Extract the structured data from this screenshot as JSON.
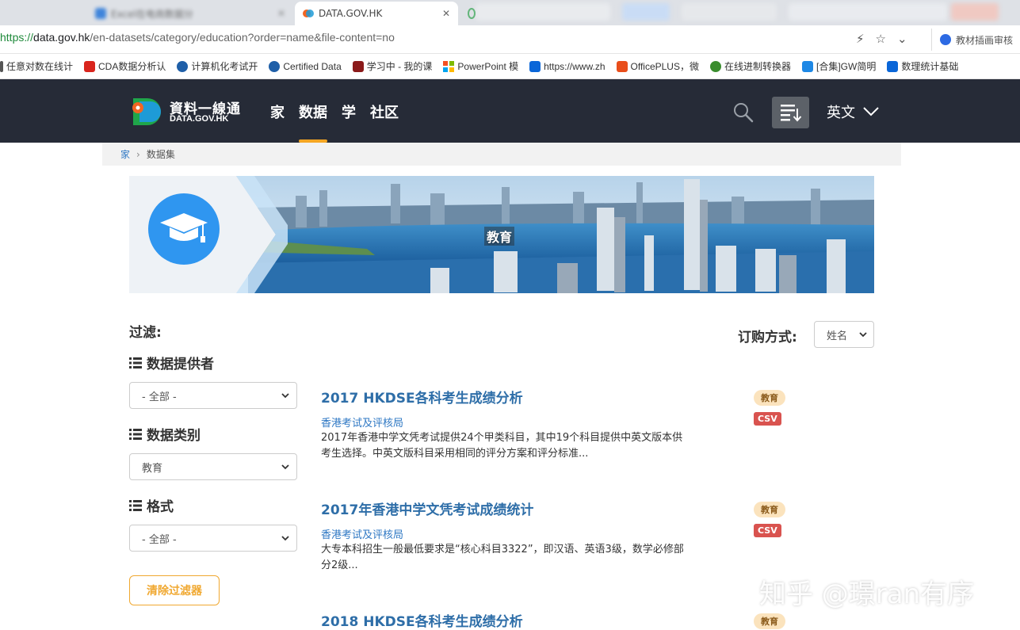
{
  "browser": {
    "tabs": [
      {
        "label": "Excel在电商数据分",
        "state": "inactive"
      },
      {
        "label": "DATA.GOV.HK",
        "state": "active"
      }
    ],
    "url": {
      "scheme": "https://",
      "host": "data.gov.hk",
      "path": "/en-datasets/category/education?order=name&file-content=no"
    },
    "side_label": "教材插画审核",
    "bookmarks": [
      {
        "label": "任意对数在线计",
        "color": "#555555"
      },
      {
        "label": "CDA数据分析认",
        "color": "#d9251d"
      },
      {
        "label": "计算机化考试开",
        "color": "#1f5fa8"
      },
      {
        "label": "Certified Data",
        "color": "#1f5fa8"
      },
      {
        "label": "学习中 - 我的课",
        "color": "#8b1a1a"
      },
      {
        "label": "PowerPoint 模",
        "color": "#e94e1b"
      },
      {
        "label": "https://www.zh",
        "color": "#0a66d8"
      },
      {
        "label": "OfficePLUS，微",
        "color": "#e94e1b"
      },
      {
        "label": "在线进制转换器",
        "color": "#3a8d2e"
      },
      {
        "label": "[合集]GW简明",
        "color": "#1e88e5"
      },
      {
        "label": "数理统计基础",
        "color": "#0a66d8"
      }
    ]
  },
  "site": {
    "logo_text": "資料一線通",
    "logo_subtext": "DATA.GOV.HK",
    "nav": [
      {
        "label": "家",
        "active": false
      },
      {
        "label": "数据",
        "active": true
      },
      {
        "label": "学",
        "active": false
      },
      {
        "label": "社区",
        "active": false
      }
    ],
    "language": "英文"
  },
  "breadcrumb": {
    "home": "家",
    "current": "数据集"
  },
  "banner": {
    "label": "教育"
  },
  "filters": {
    "title": "过滤:",
    "groups": [
      {
        "heading": "数据提供者",
        "value": "- 全部 -"
      },
      {
        "heading": "数据类别",
        "value": "教育"
      },
      {
        "heading": "格式",
        "value": "- 全部 -"
      }
    ],
    "clear_label": "清除过滤器"
  },
  "sort": {
    "label": "订购方式:",
    "value": "姓名"
  },
  "results": [
    {
      "title": "2017 HKDSE各科考生成绩分析",
      "provider": "香港考试及评核局",
      "description": "2017年香港中学文凭考试提供24个甲类科目，其中19个科目提供中英文版本供考生选择。中英文版科目采用相同的评分方案和评分标准...",
      "category": "教育",
      "format": "CSV"
    },
    {
      "title": "2017年香港中学文凭考试成绩统计",
      "provider": "香港考试及评核局",
      "description": "大专本科招生一般最低要求是“核心科目3322”，即汉语、英语3级，数学必修部分2级...",
      "category": "教育",
      "format": "CSV"
    },
    {
      "title": "2018 HKDSE各科考生成绩分析",
      "provider": "",
      "description": "",
      "category": "教育",
      "format": ""
    }
  ],
  "watermark": "知乎 @璟ran有序"
}
